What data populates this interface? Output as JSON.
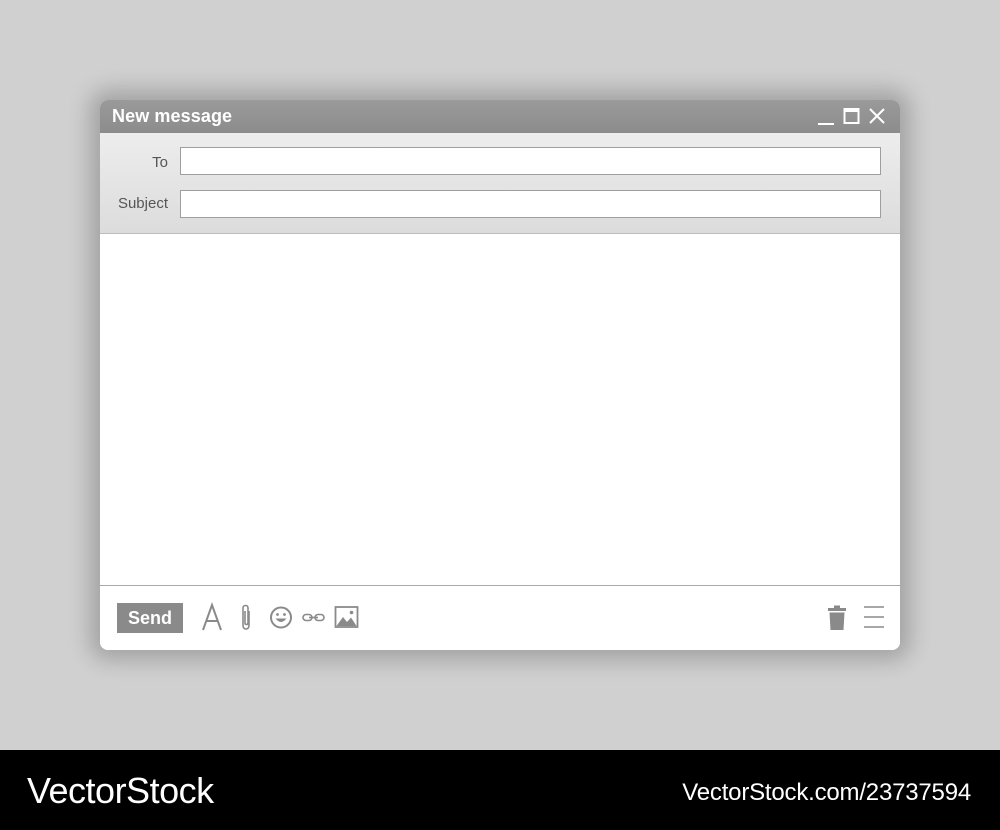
{
  "window": {
    "title": "New message"
  },
  "fields": {
    "to_label": "To",
    "to_value": "",
    "subject_label": "Subject",
    "subject_value": ""
  },
  "message": {
    "body_value": ""
  },
  "toolbar": {
    "send_label": "Send",
    "tools": [
      "font-icon",
      "paperclip-icon",
      "smiley-icon",
      "link-icon",
      "image-icon",
      "trash-icon",
      "menu-icon"
    ]
  },
  "colors": {
    "titlebar": "#8c8c8c",
    "send_button": "#8a8a8a",
    "icon": "#8a8a8a",
    "background": "#d0d0d0"
  },
  "watermark": {
    "brand": "VectorStock",
    "image_ref": "VectorStock.com/23737594"
  }
}
